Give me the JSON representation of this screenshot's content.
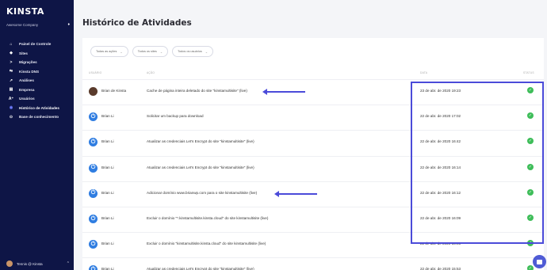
{
  "sidebar": {
    "logo": "KINSTA",
    "company": "Awesome Company",
    "items": [
      {
        "label": "Painel de Controle",
        "icon": "home-icon",
        "glyph": "⌂"
      },
      {
        "label": "Sites",
        "icon": "sites-icon",
        "glyph": "◆"
      },
      {
        "label": "Migrações",
        "icon": "migration-icon",
        "glyph": ">"
      },
      {
        "label": "Kinsta DNS",
        "icon": "dns-icon",
        "glyph": "⇆"
      },
      {
        "label": "Análises",
        "icon": "analytics-icon",
        "glyph": "↗"
      },
      {
        "label": "Empresa",
        "icon": "company-icon",
        "glyph": "▤"
      },
      {
        "label": "Usuários",
        "icon": "users-icon",
        "glyph": "A⁺"
      },
      {
        "label": "Histórico de Atividades",
        "icon": "activity-icon",
        "glyph": "◉"
      },
      {
        "label": "Base de conhecimento",
        "icon": "knowledge-icon",
        "glyph": "⊙"
      }
    ],
    "user": "Tennis @ Kinsta"
  },
  "main": {
    "title": "Histórico de Atividades",
    "filters": [
      "Todas as ações",
      "Todos os sites",
      "Todos os usuários"
    ],
    "headers": {
      "user": "USUÁRIO",
      "action": "AÇÃO",
      "date": "DATA",
      "status": "STATUS"
    },
    "rows": [
      {
        "user": "Brian de Kinsta",
        "avatar": "photo",
        "action": "Cache de página inteira deletado do site \"kinstamultisite\" (live)",
        "date": "23 de abr. de 2020 19:23",
        "arrow": true
      },
      {
        "user": "Brian Li",
        "avatar": "power",
        "action": "Solicitar um backup para download",
        "date": "22 de abr. de 2020 17:02"
      },
      {
        "user": "Brian Li",
        "avatar": "power",
        "action": "Atualizar as credenciais Let's Encrypt do site \"kinstamultisite\" (live)",
        "date": "22 de abr. de 2020 16:42"
      },
      {
        "user": "Brian Li",
        "avatar": "power",
        "action": "Atualizar as credenciais Let's Encrypt do site \"kinstamultisite\" (live)",
        "date": "22 de abr. de 2020 16:14"
      },
      {
        "user": "Brian Li",
        "avatar": "power",
        "action": "Adicionar domínio www.brianwp.com para o site kinstamultisite (live)",
        "date": "22 de abr. de 2020 16:12",
        "arrow": true
      },
      {
        "user": "Brian Li",
        "avatar": "power",
        "action": "Excluir o domínio \"*.kinstamultisite.kinsta.cloud\" do site kinstamultisite (live)",
        "date": "22 de abr. de 2020 16:09"
      },
      {
        "user": "Brian Li",
        "avatar": "power",
        "action": "Excluir o domínio \"kinstamultisite.kinsta.cloud\" do site kinstamultisite (live)",
        "date": "22 de abr. de 2020 16:05"
      },
      {
        "user": "Brian Li",
        "avatar": "power",
        "action": "Atualizar as credenciais Let's Encrypt do site \"kinstamultisite\" (live)",
        "date": "22 de abr. de 2020 15:53"
      }
    ]
  },
  "colors": {
    "sidebar": "#0e1546",
    "accent": "#4b4bd9",
    "success": "#3ebd59"
  }
}
